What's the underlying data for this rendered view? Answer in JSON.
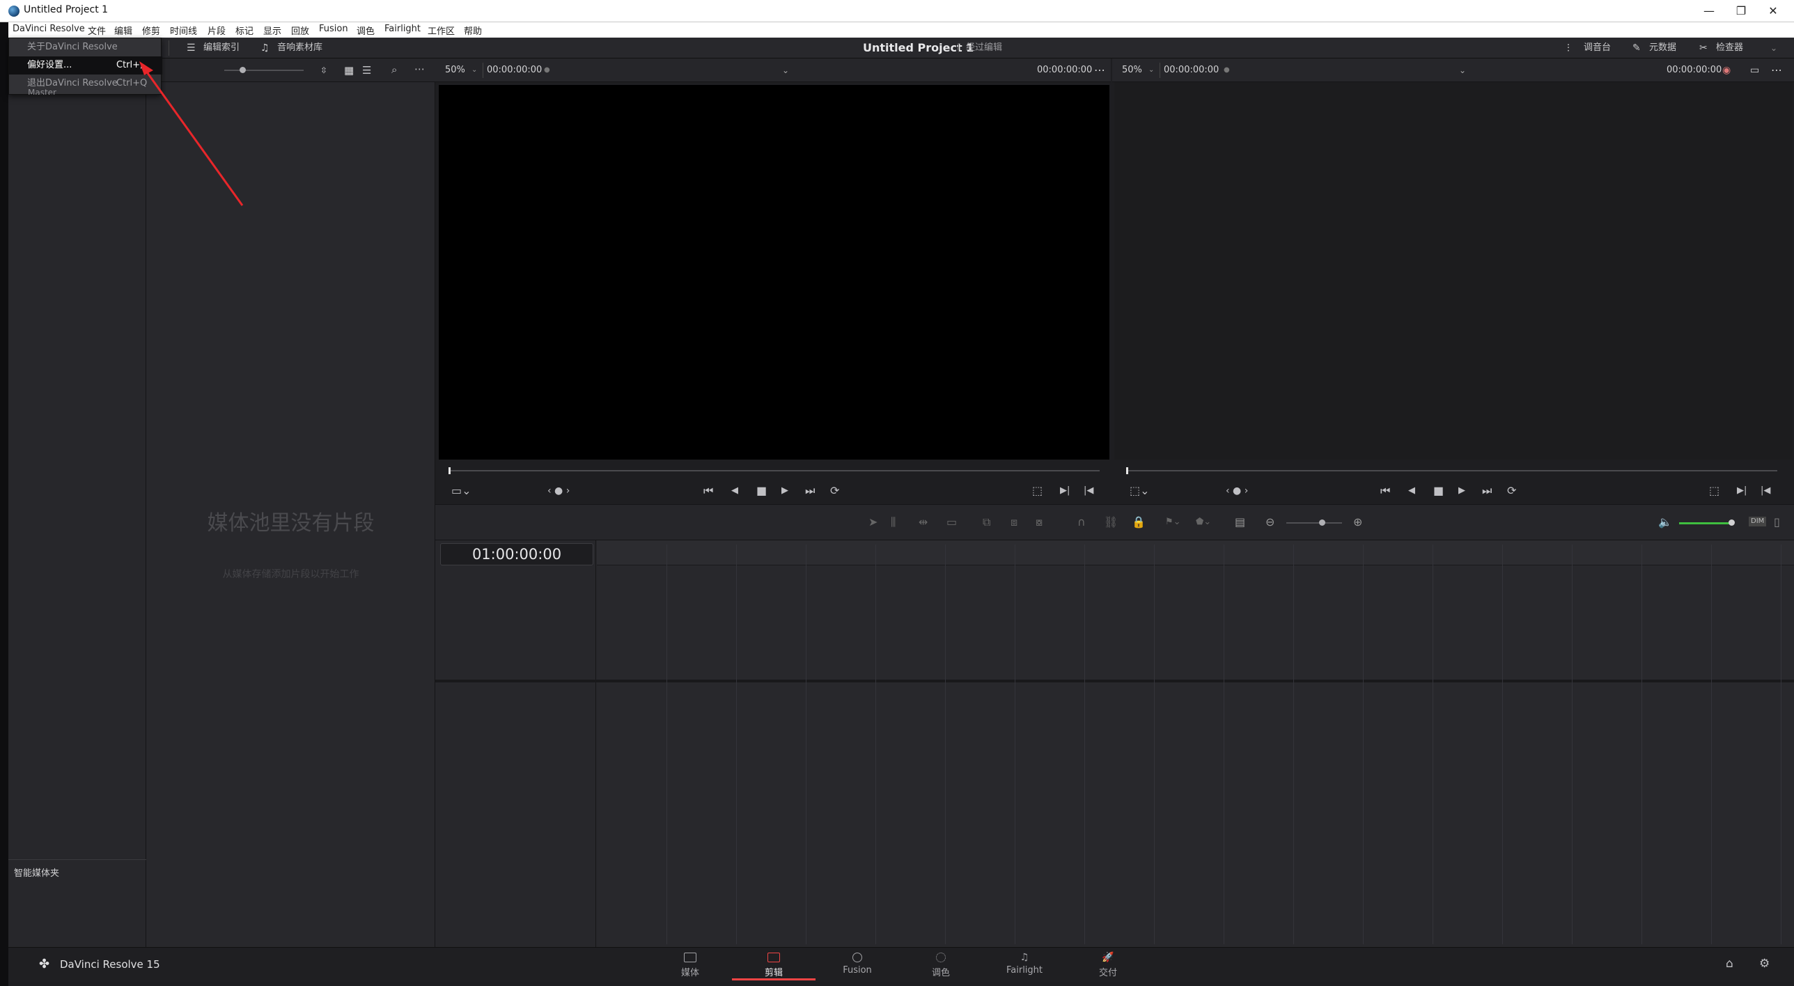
{
  "window": {
    "title": "Untitled Project 1",
    "controls": {
      "minimize": "—",
      "restore": "❐",
      "close": "✕"
    }
  },
  "menubar": {
    "items": [
      "DaVinci Resolve",
      "文件",
      "编辑",
      "修剪",
      "时间线",
      "片段",
      "标记",
      "显示",
      "回放",
      "Fusion",
      "调色",
      "Fairlight",
      "工作区",
      "帮助"
    ]
  },
  "dropdown": {
    "about": "关于DaVinci Resolve",
    "preferences": {
      "label": "偏好设置...",
      "shortcut": "Ctrl+,"
    },
    "quit": {
      "label": "退出DaVinci Resolve",
      "shortcut": "Ctrl+Q"
    },
    "peek_text": "Master"
  },
  "toolbar": {
    "edit_index": "编辑索引",
    "sound_library": "音响素材库",
    "project_title": "Untitled Project 1",
    "project_subtitle": "经过编辑",
    "mixer": "调音台",
    "metadata": "元数据",
    "inspector": "检查器"
  },
  "source_viewer": {
    "zoom": "50%",
    "timecode_left": "00:00:00:00",
    "timecode_right": "00:00:00:00"
  },
  "record_viewer": {
    "zoom": "50%",
    "timecode_left": "00:00:00:00",
    "timecode_right": "00:00:00:00"
  },
  "media_pool": {
    "empty_title": "媒体池里没有片段",
    "empty_hint": "从媒体存储添加片段以开始工作"
  },
  "bins": {
    "smart_bins": "智能媒体夹"
  },
  "timeline": {
    "timecode": "01:00:00:00",
    "dim_label": "DIM"
  },
  "pagebar": {
    "brand": "DaVinci Resolve 15",
    "pages": [
      "媒体",
      "剪辑",
      "Fusion",
      "调色",
      "Fairlight",
      "交付"
    ],
    "active_page": "剪辑"
  },
  "colors": {
    "accent_red": "#e44444",
    "annotation_arrow": "#e8262a",
    "volume_green": "#3fbf3f"
  }
}
